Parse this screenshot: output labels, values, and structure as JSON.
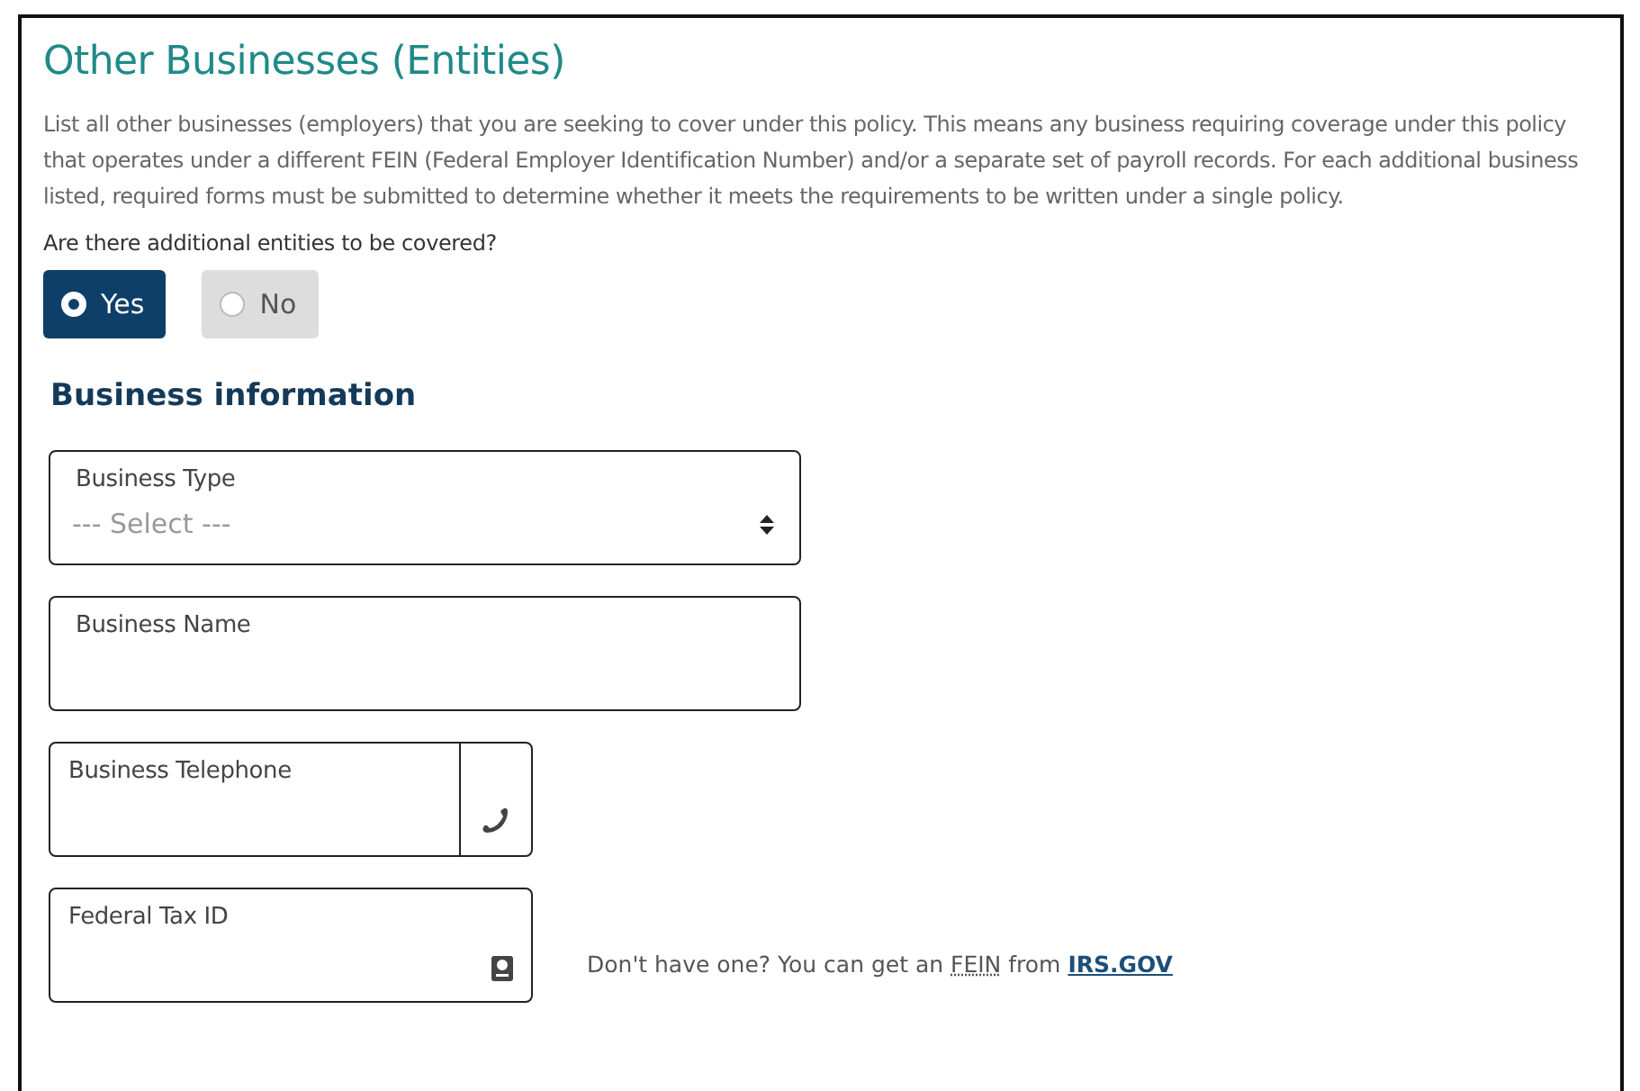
{
  "title": "Other Businesses (Entities)",
  "description": "List all other businesses (employers) that you are seeking to cover under this policy. This means any business requiring coverage under this policy that operates under a different FEIN (Federal Employer Identification Number) and/or a separate set of payroll records. For each additional business listed, required forms must be submitted to determine whether it meets the requirements to be written under a single policy.",
  "question": "Are there additional entities to be covered?",
  "options": [
    {
      "label": "Yes",
      "selected": true
    },
    {
      "label": "No",
      "selected": false
    }
  ],
  "section_title": "Business information",
  "fields": [
    {
      "kind": "select",
      "label": "Business Type",
      "placeholder": "--- Select ---"
    },
    {
      "kind": "text",
      "label": "Business Name"
    },
    {
      "kind": "phone",
      "label": "Business Telephone"
    },
    {
      "kind": "taxid",
      "label": "Federal Tax ID"
    }
  ],
  "help": {
    "before": "Don't have one? You can get an ",
    "abbr": "FEIN",
    "after": " from ",
    "link": "IRS.GOV"
  }
}
